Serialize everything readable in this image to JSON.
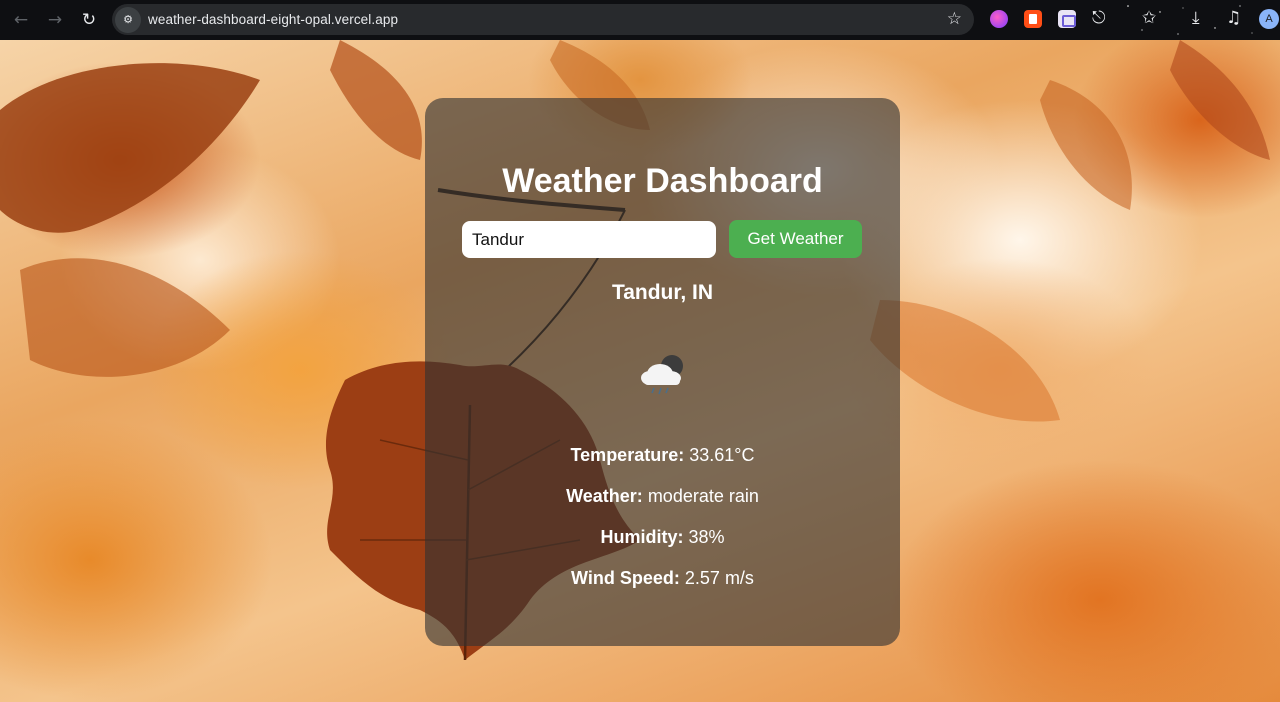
{
  "browser": {
    "url": "weather-dashboard-eight-opal.vercel.app",
    "profile_initial": "A",
    "icons": [
      "back-arrow-icon",
      "forward-arrow-icon",
      "reload-icon",
      "site-info-icon",
      "bookmark-star-icon",
      "extensions-puzzle-icon",
      "download-icon",
      "media-control-icon"
    ]
  },
  "dashboard": {
    "title": "Weather Dashboard",
    "search": {
      "value": "Tandur",
      "button_label": "Get Weather"
    },
    "location": "Tandur, IN",
    "icon": "cloud-rain-icon",
    "stats": [
      {
        "label": "Temperature:",
        "value": "33.61°C"
      },
      {
        "label": "Weather:",
        "value": "moderate rain"
      },
      {
        "label": "Humidity:",
        "value": "38%"
      },
      {
        "label": "Wind Speed:",
        "value": "2.57 m/s"
      }
    ]
  },
  "colors": {
    "card_bg": "rgba(50,50,50,0.62)",
    "button": "#4caf50",
    "chrome": "#0e0f12"
  }
}
